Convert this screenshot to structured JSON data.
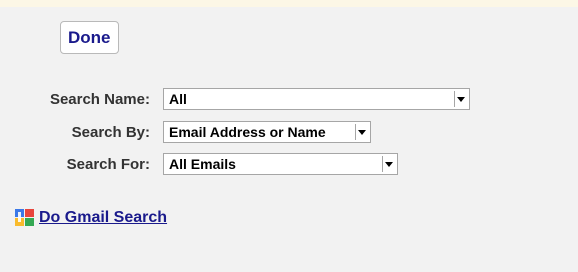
{
  "toolbar": {
    "done_label": "Done"
  },
  "form": {
    "search_name_label": "Search Name:",
    "search_name_value": "All",
    "search_by_label": "Search By:",
    "search_by_value": "Email Address or Name",
    "search_for_label": "Search For:",
    "search_for_value": "All Emails"
  },
  "gmail": {
    "link_label": "Do Gmail Search",
    "logo_icon": "google-logo-icon"
  },
  "colors": {
    "background": "#f2f2f2",
    "link": "#1a1a8c",
    "label": "#333333",
    "top_strip": "#fcf7e6"
  }
}
